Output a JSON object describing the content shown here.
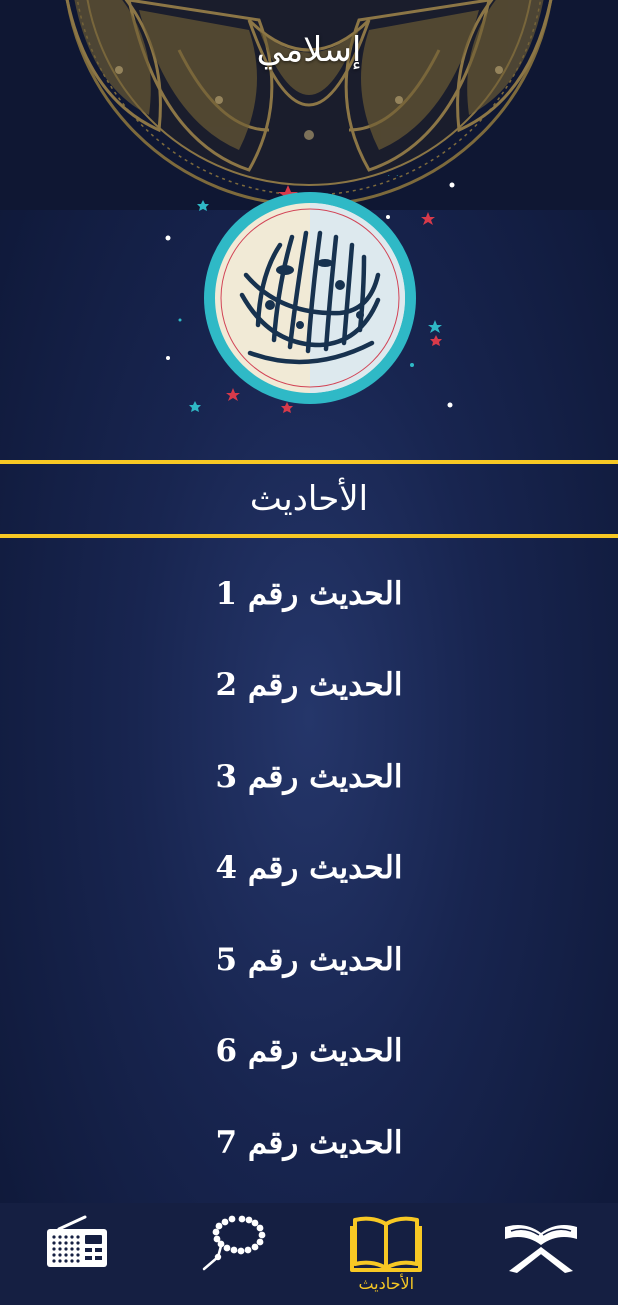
{
  "app": {
    "title": "إسلامي"
  },
  "section": {
    "title": "الأحاديث"
  },
  "hadiths": [
    {
      "label": "الحديث رقم 1"
    },
    {
      "label": "الحديث رقم 2"
    },
    {
      "label": "الحديث رقم 3"
    },
    {
      "label": "الحديث رقم 4"
    },
    {
      "label": "الحديث رقم 5"
    },
    {
      "label": "الحديث رقم 6"
    },
    {
      "label": "الحديث رقم 7"
    }
  ],
  "bottom_nav": {
    "items": [
      {
        "icon": "radio-icon",
        "label": ""
      },
      {
        "icon": "tasbeeh-icon",
        "label": ""
      },
      {
        "icon": "book-icon",
        "label": "الأحاديث",
        "active": true
      },
      {
        "icon": "quran-icon",
        "label": ""
      }
    ]
  },
  "colors": {
    "accent": "#f7c824",
    "background": "#182550",
    "nav_background": "#151f42",
    "emblem_ring": "#2fb9c6"
  }
}
